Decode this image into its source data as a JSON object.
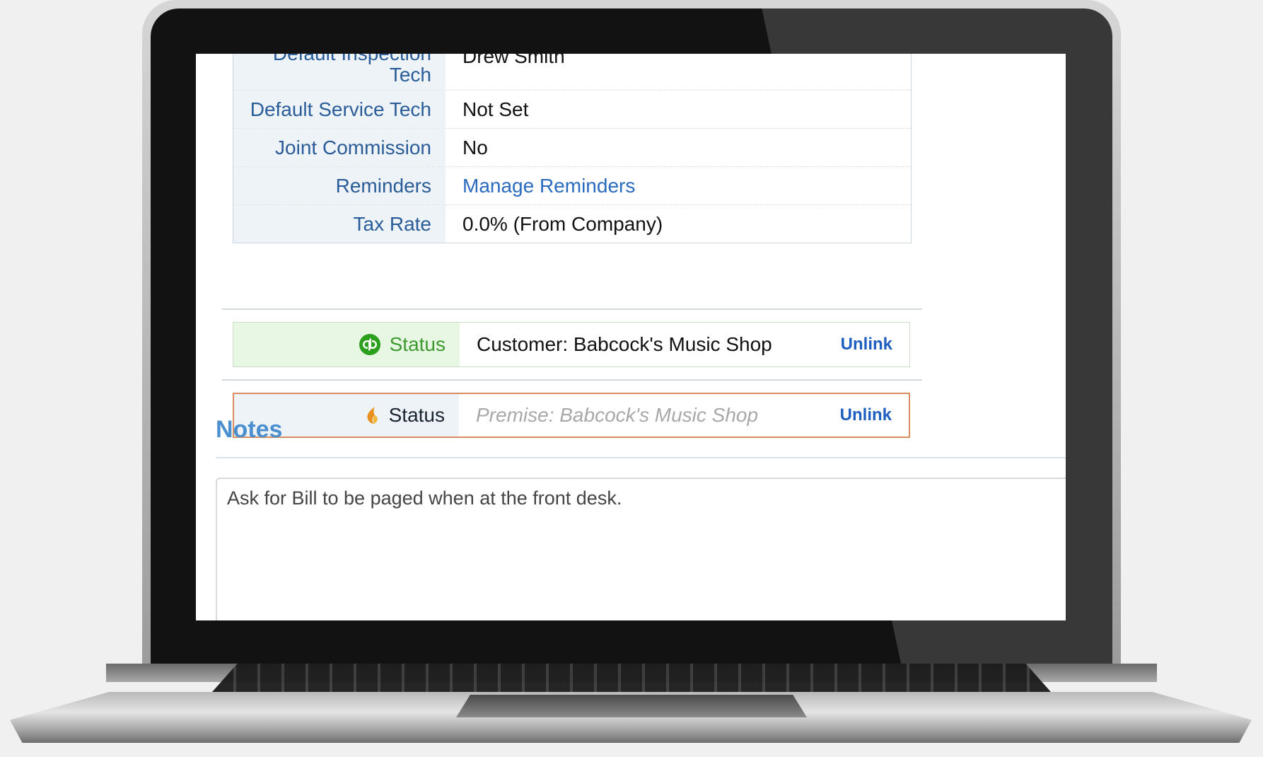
{
  "details": [
    {
      "label": "Default Inspection Tech",
      "value": "Drew Smith"
    },
    {
      "label": "Default Service Tech",
      "value": "Not Set"
    },
    {
      "label": "Joint Commission",
      "value": "No"
    },
    {
      "label": "Reminders",
      "value": "Manage Reminders",
      "is_link": true
    },
    {
      "label": "Tax Rate",
      "value": "0.0% (From Company)"
    }
  ],
  "quickbooks_sync": {
    "icon": "quickbooks-icon",
    "label": "Status",
    "value": "Customer: Babcock's Music Shop",
    "action": "Unlink",
    "color": "#3c9a2e"
  },
  "firefly_sync": {
    "icon": "flame-icon",
    "label": "Status",
    "value": "Premise: Babcock's Music Shop",
    "action": "Unlink",
    "color": "#e08a2a"
  },
  "notes": {
    "title": "Notes",
    "text": "Ask for Bill to be paged when at the front desk."
  },
  "colors": {
    "label_text": "#2a5c99",
    "link": "#2a6bbf",
    "notes_heading": "#4a8fd0"
  }
}
